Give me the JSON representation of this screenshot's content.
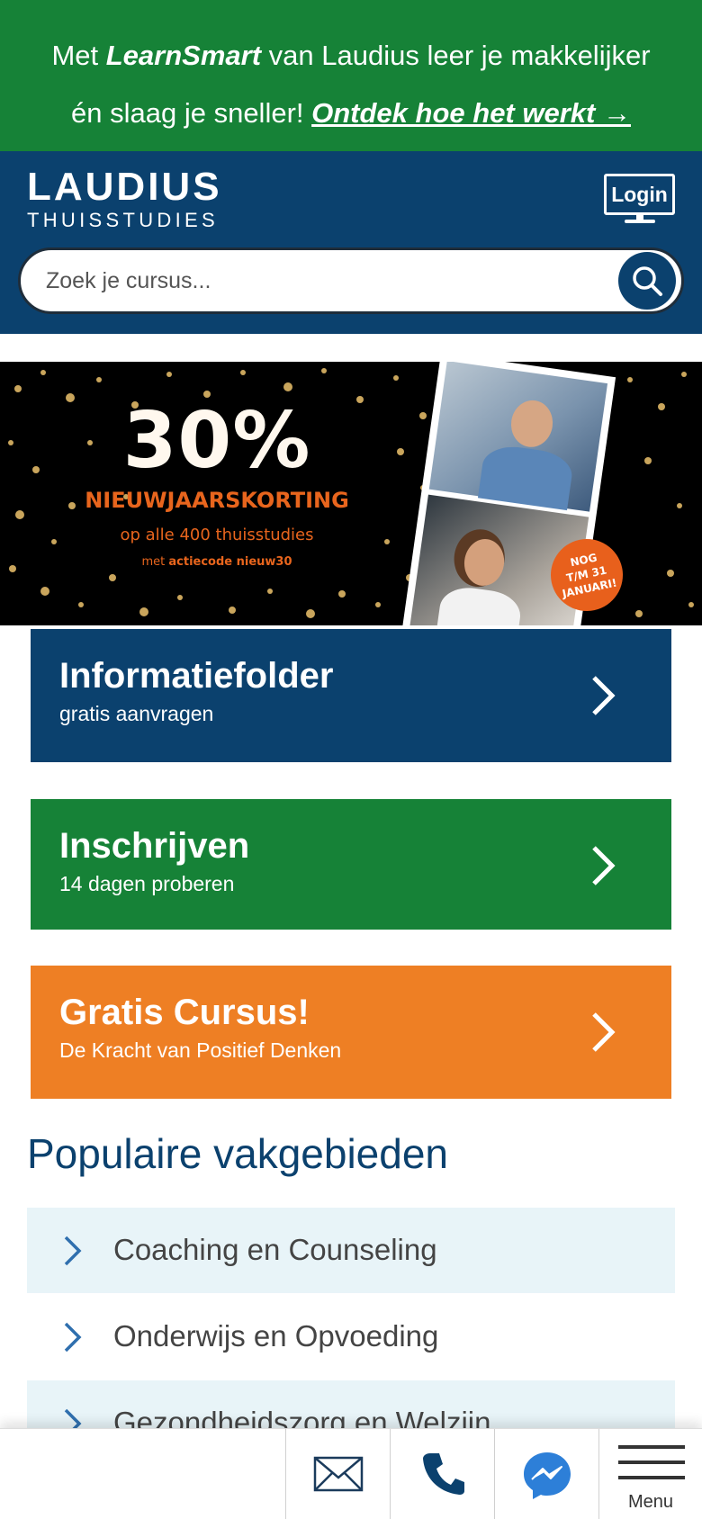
{
  "promo": {
    "prefix": "Met ",
    "brand": "LearnSmart",
    "mid": " van Laudius leer je makkelijker",
    "line2": "én slaag je sneller! ",
    "link": "Ontdek hoe het werkt →"
  },
  "header": {
    "logo_main": "LAUDIUS",
    "logo_sub": "THUISSTUDIES",
    "login_label": "Login"
  },
  "search": {
    "placeholder": "Zoek je cursus..."
  },
  "banner": {
    "percentage": "30%",
    "headline": "NIEUWJAARSKORTING",
    "subline": "op alle 400 thuisstudies",
    "code_prefix": "met ",
    "code_text": "actiecode nieuw30",
    "badge_line1": "NOG",
    "badge_line2": "T/M 31",
    "badge_line3": "JANUARI!"
  },
  "cta": [
    {
      "title": "Informatiefolder",
      "subtitle": "gratis aanvragen",
      "color": "#0b416e"
    },
    {
      "title": "Inschrijven",
      "subtitle": "14 dagen proberen",
      "color": "#168237"
    },
    {
      "title": "Gratis Cursus!",
      "subtitle": "De Kracht van Positief Denken",
      "color": "#ee7f24"
    }
  ],
  "popular": {
    "title": "Populaire vakgebieden",
    "items": [
      {
        "label": "Coaching en Counseling"
      },
      {
        "label": "Onderwijs en Opvoeding"
      },
      {
        "label": "Gezondheidszorg en Welzijn"
      }
    ]
  },
  "bottom_nav": {
    "items": [
      {
        "icon": "mail-icon"
      },
      {
        "icon": "phone-icon"
      },
      {
        "icon": "messenger-icon"
      },
      {
        "icon": "menu-icon",
        "label": "Menu"
      }
    ]
  },
  "colors": {
    "brand_blue": "#0b416e",
    "brand_green": "#168237",
    "brand_orange": "#ee7f24"
  }
}
